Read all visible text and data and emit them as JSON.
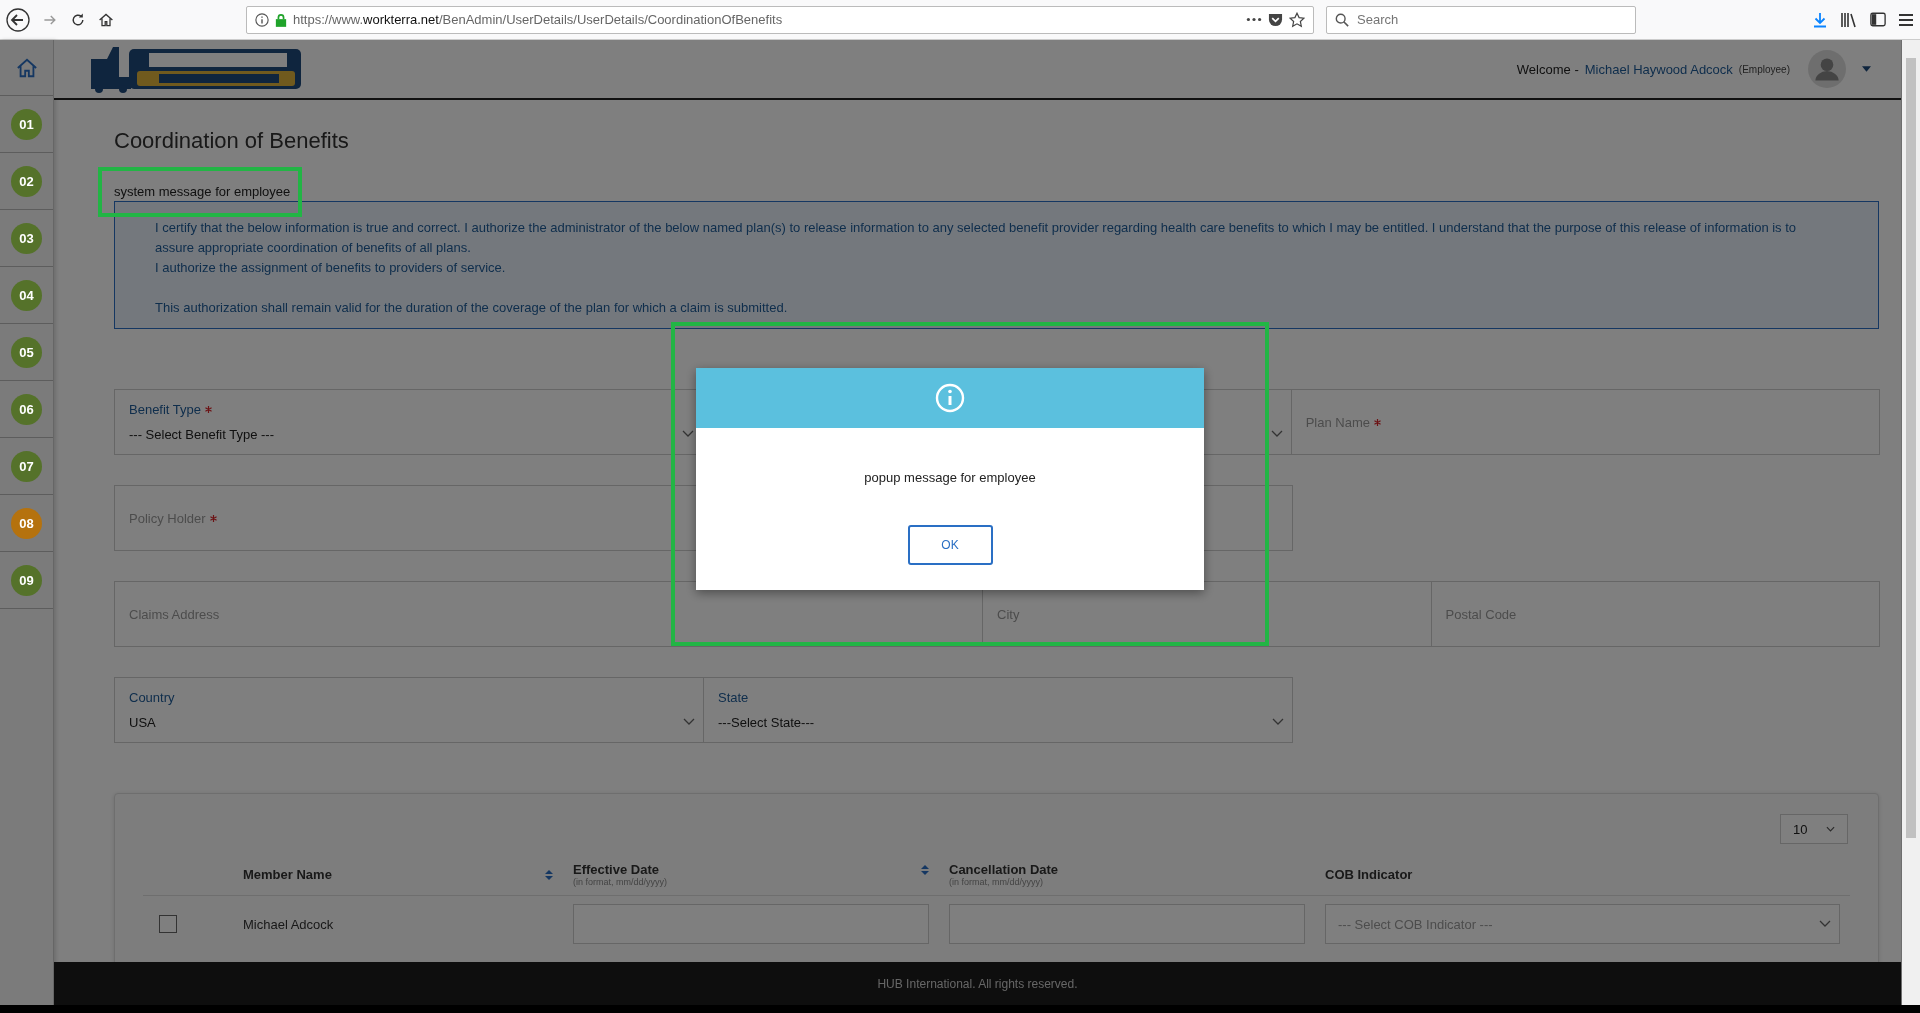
{
  "browser": {
    "url_prefix": "https://www.",
    "url_domain": "workterra.net",
    "url_path": "/BenAdmin/UserDetails/UserDetails/CoordinationOfBenefits",
    "search_placeholder": "Search"
  },
  "header": {
    "welcome": "Welcome -",
    "user_name": "Michael Haywood Adcock",
    "user_role": "(Employee)"
  },
  "sidebar": {
    "items": [
      {
        "label": "01",
        "color": "#55722a"
      },
      {
        "label": "02",
        "color": "#55722a"
      },
      {
        "label": "03",
        "color": "#55722a"
      },
      {
        "label": "04",
        "color": "#55722a"
      },
      {
        "label": "05",
        "color": "#55722a"
      },
      {
        "label": "06",
        "color": "#55722a"
      },
      {
        "label": "07",
        "color": "#55722a"
      },
      {
        "label": "08",
        "color": "#b5720e"
      },
      {
        "label": "09",
        "color": "#55722a"
      }
    ]
  },
  "page": {
    "title": "Coordination of Benefits",
    "system_message": "system message for employee",
    "notice": [
      "I certify that the below information is true and correct. I authorize the administrator of the below named plan(s) to release information to any selected benefit provider regarding health care benefits to which I may be entitled. I understand that the purpose of this release of information is to assure appropriate coordination of benefits of all plans.",
      "I authorize the assignment of benefits to providers of service.",
      "This authorization shall remain valid for the duration of the coverage of the plan for which a claim is submitted."
    ]
  },
  "form": {
    "rows": [
      {
        "fields": [
          {
            "kind": "select",
            "label": "Benefit Type",
            "value": "--- Select Benefit Type ---",
            "required": true
          },
          {
            "kind": "select"
          },
          {
            "kind": "text",
            "placeholder": "Plan Name",
            "required": true
          }
        ]
      },
      {
        "fields": [
          {
            "kind": "text",
            "placeholder": "Policy Holder",
            "required": true
          },
          {
            "kind": "text"
          },
          {
            "kind": "blank"
          }
        ]
      },
      {
        "fields": [
          {
            "kind": "text",
            "placeholder": "Claims Address",
            "required": false,
            "wide": true
          },
          {
            "kind": "text",
            "placeholder": "City",
            "required": false
          },
          {
            "kind": "text",
            "placeholder": "Postal Code",
            "required": false
          }
        ]
      },
      {
        "fields": [
          {
            "kind": "select",
            "label": "Country",
            "value": "USA",
            "required": false
          },
          {
            "kind": "select",
            "label": "State",
            "value": "---Select State---",
            "required": false
          },
          {
            "kind": "blank"
          }
        ]
      }
    ]
  },
  "table": {
    "page_size": "10",
    "columns": [
      {
        "label": "Member Name",
        "sortable": true
      },
      {
        "label": "Effective Date",
        "hint": "(in format, mm/dd/yyyy)",
        "sortable": true
      },
      {
        "label": "Cancellation Date",
        "hint": "(in format, mm/dd/yyyy)",
        "sortable": false
      },
      {
        "label": "COB Indicator",
        "sortable": false
      }
    ],
    "rows": [
      {
        "checked": false,
        "member_name": "Michael Adcock",
        "cob_placeholder": "--- Select COB Indicator ---"
      }
    ]
  },
  "footer": "HUB International. All rights reserved.",
  "modal": {
    "message": "popup message for employee",
    "button": "OK"
  },
  "annotations": [
    {
      "kind": "frame"
    },
    {
      "kind": "frame"
    }
  ]
}
